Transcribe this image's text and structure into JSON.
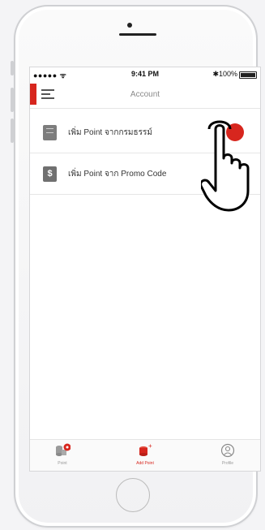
{
  "status_bar": {
    "signal": "●●●●● ᯤ",
    "time": "9:41 PM",
    "battery": "✱100%"
  },
  "nav": {
    "title": "Account"
  },
  "rows": [
    {
      "label": "เพิ่ม Point จากกรมธรรม์",
      "icon": "book-icon"
    },
    {
      "label": "เพิ่ม Point จาก Promo Code",
      "icon": "coupon-icon"
    }
  ],
  "tabs": [
    {
      "label": "Point",
      "icon": "coins-icon",
      "badge": ""
    },
    {
      "label": "Add Point",
      "icon": "add-coins-icon"
    },
    {
      "label": "Profile",
      "icon": "profile-icon"
    }
  ],
  "colors": {
    "accent": "#d7261e",
    "plus_button": "#e9462b"
  }
}
